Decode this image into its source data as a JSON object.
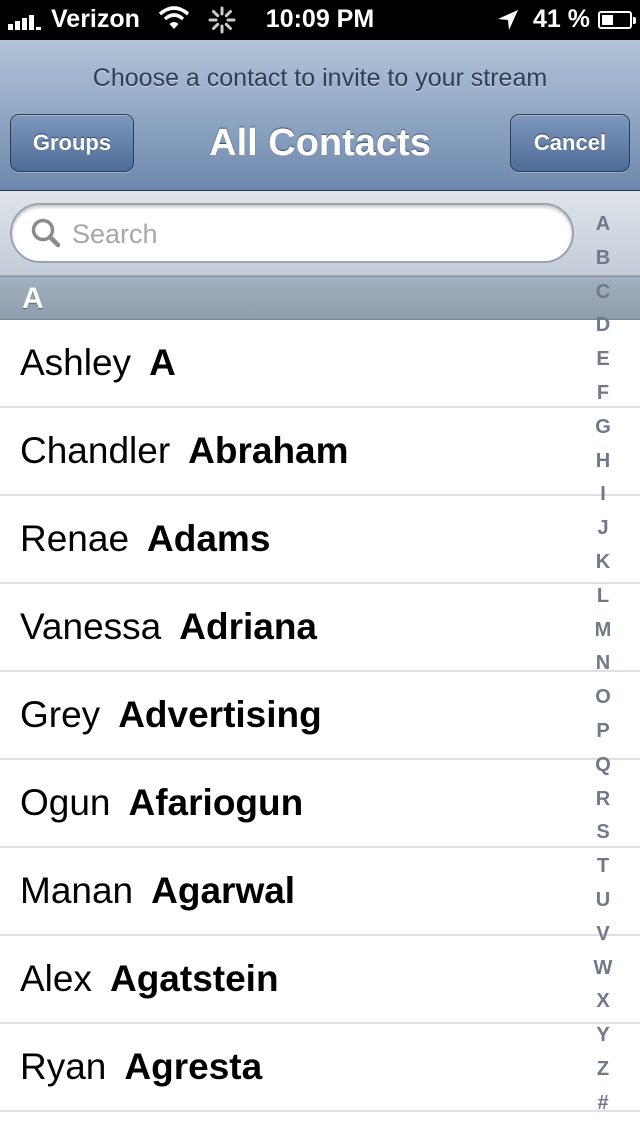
{
  "status_bar": {
    "carrier": "Verizon",
    "time": "10:09 PM",
    "battery": "41 %",
    "battery_level": 0.41
  },
  "nav_bar": {
    "prompt": "Choose a contact to invite to your stream",
    "title": "All Contacts",
    "left_button": "Groups",
    "right_button": "Cancel"
  },
  "search": {
    "placeholder": "Search",
    "value": ""
  },
  "section": {
    "header": "A"
  },
  "contacts": [
    {
      "first": "Ashley",
      "last": "A"
    },
    {
      "first": "Chandler",
      "last": "Abraham"
    },
    {
      "first": "Renae",
      "last": "Adams"
    },
    {
      "first": "Vanessa",
      "last": "Adriana"
    },
    {
      "first": "Grey",
      "last": "Advertising"
    },
    {
      "first": "Ogun",
      "last": "Afariogun"
    },
    {
      "first": "Manan",
      "last": "Agarwal"
    },
    {
      "first": "Alex",
      "last": "Agatstein"
    },
    {
      "first": "Ryan",
      "last": "Agresta"
    }
  ],
  "index_letters": [
    "A",
    "B",
    "C",
    "D",
    "E",
    "F",
    "G",
    "H",
    "I",
    "J",
    "K",
    "L",
    "M",
    "N",
    "O",
    "P",
    "Q",
    "R",
    "S",
    "T",
    "U",
    "V",
    "W",
    "X",
    "Y",
    "Z",
    "#"
  ],
  "colors": {
    "nav_bar": "#8da4c2",
    "button": "#4d6c96",
    "index_text": "#70798a"
  }
}
